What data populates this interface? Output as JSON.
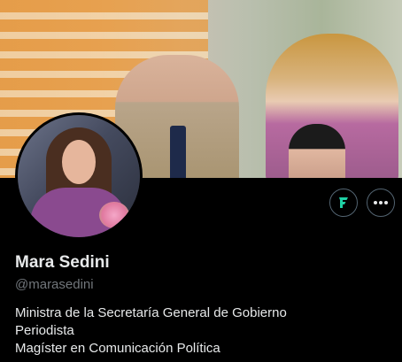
{
  "profile": {
    "display_name": "Mara Sedini",
    "handle": "@marasedini",
    "bio_lines": [
      "Ministra de la Secretaría General de Gobierno",
      "Periodista",
      "Magíster en Comunicación Política"
    ]
  },
  "actions": {
    "follow_icon": "f-logo-icon",
    "more_icon": "more-icon"
  },
  "colors": {
    "background": "#000000",
    "primary_text": "#e7e9ea",
    "secondary_text": "#71767b",
    "accent": "#1fd1a5",
    "button_border": "#536471"
  }
}
